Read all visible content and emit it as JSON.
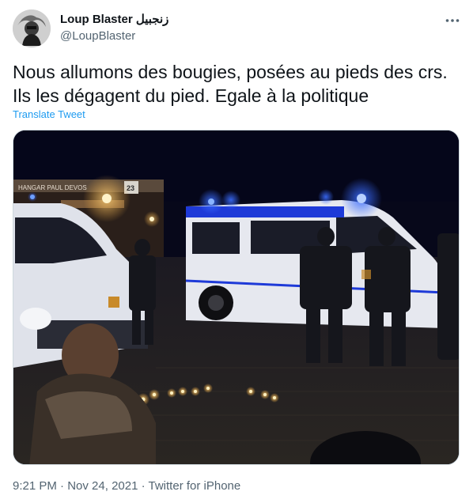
{
  "author": {
    "display_name": "Loup Blaster زنجبيل",
    "handle": "@LoupBlaster"
  },
  "tweet": {
    "line1": "Nous allumons des bougies, posées au pieds des crs.",
    "line2": "Ils les dégagent du pied. Egale à la politique",
    "translate_label": "Translate Tweet"
  },
  "media": {
    "sign_text": "HANGAR PAUL DEVOS",
    "sign_number": "23"
  },
  "meta": {
    "time": "9:21 PM",
    "separator": " · ",
    "date": "Nov 24, 2021",
    "source": "Twitter for iPhone"
  },
  "icons": {
    "more": "more-horizontal-icon"
  },
  "colors": {
    "link": "#1d9bf0",
    "secondary_text": "#536471",
    "primary_text": "#0f1419"
  }
}
